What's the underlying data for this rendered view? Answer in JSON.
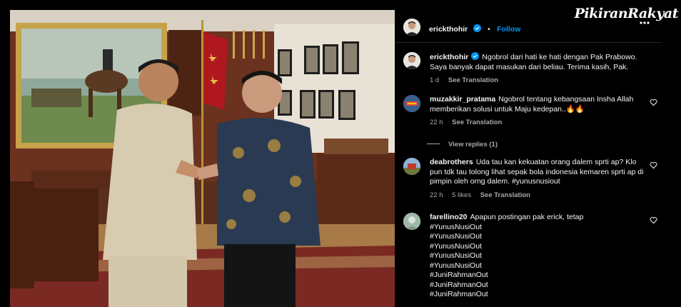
{
  "logo": {
    "text": "PikiranRakyat"
  },
  "header": {
    "username": "erickthohir",
    "follow_label": "Follow"
  },
  "caption": {
    "username": "erickthohir",
    "text": "Ngobrol dari hati ke hati dengan Pak Prabowo. Saya banyak dapat masukan dari beliau. Terima kasih, Pak.",
    "time": "1 d",
    "see_translation": "See Translation"
  },
  "comments": [
    {
      "username": "muzakkir_pratama",
      "text": "Ngobrol tentang kebangsaan Insha Allah memberikan solusi untuk Maju kedepan..🔥🔥",
      "time": "22 h",
      "see_translation": "See Translation",
      "view_replies": "View replies (1)"
    },
    {
      "username": "deabrothers",
      "text": "Uda tau kan kekuatan orang dalem sprti ap? Klo pun tdk tau tolong lihat sepak bola indonesia kemaren sprti ap di pimpin oleh orng dalem. #yunusnusiout",
      "time": "22 h",
      "likes": "5 likes",
      "see_translation": "See Translation"
    },
    {
      "username": "farellino20",
      "text": "Apapun postingan pak erick, tetap",
      "tags": [
        "#YunusNusiOut",
        "#YunusNusiOut",
        "#YunusNusiOut",
        "#YunusNusiOut",
        "#YunusNusiOut",
        "#JuniRahmanOut",
        "#JuniRahmanOut",
        "#JuniRahmanOut"
      ]
    }
  ],
  "colors": {
    "follow": "#0095f6",
    "muted": "#a8a8a8",
    "background": "#000000",
    "divider": "#262626"
  },
  "icons": [
    "verified-badge-icon",
    "heart-icon"
  ]
}
